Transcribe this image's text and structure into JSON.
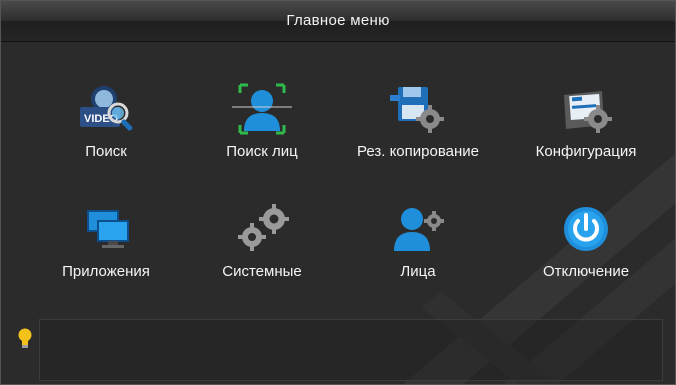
{
  "window": {
    "title": "Главное меню"
  },
  "menu": [
    {
      "label": "Поиск",
      "icon": "video-search-icon"
    },
    {
      "label": "Поиск лиц",
      "icon": "face-scan-icon"
    },
    {
      "label": "Рез. копирование",
      "icon": "backup-floppy-gear-icon"
    },
    {
      "label": "Конфигурация",
      "icon": "config-settings-gear-icon"
    },
    {
      "label": "Приложения",
      "icon": "monitors-icon"
    },
    {
      "label": "Системные",
      "icon": "gears-icon"
    },
    {
      "label": "Лица",
      "icon": "user-gear-icon"
    },
    {
      "label": "Отключение",
      "icon": "power-icon"
    }
  ],
  "hint": {
    "icon": "lightbulb-icon",
    "text": ""
  },
  "colors": {
    "accent": "#1f8fdc",
    "background": "#2b2b2b",
    "text": "#f5f5f5"
  }
}
